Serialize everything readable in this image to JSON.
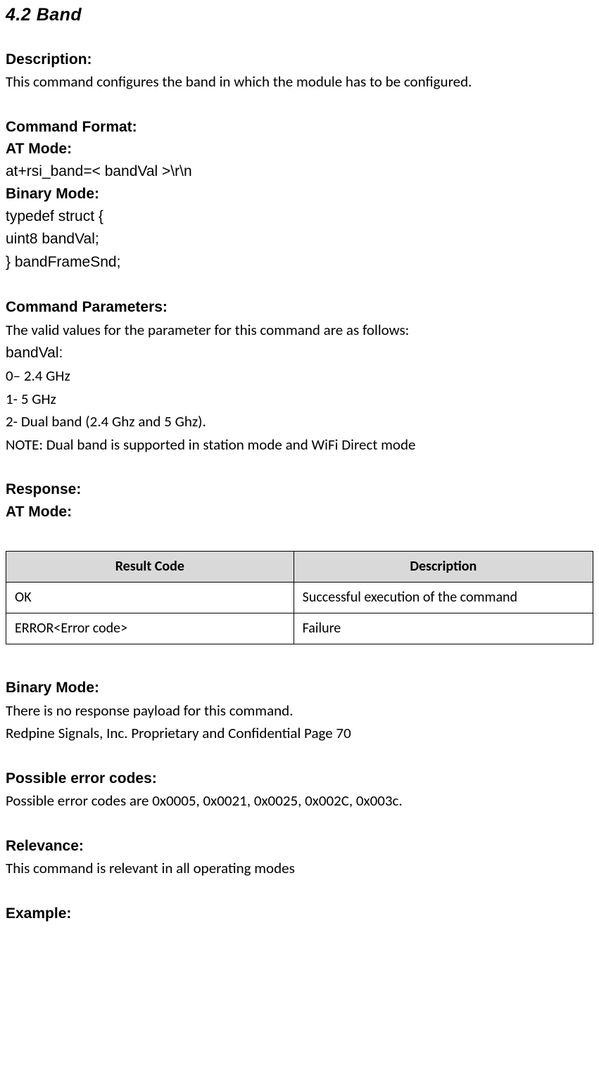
{
  "title": "4.2 Band",
  "description": {
    "heading": "Description:",
    "text": "This command configures the band in which the module has to be configured."
  },
  "command_format": {
    "heading": "Command Format:",
    "at_mode_label": "AT Mode:",
    "at_mode_cmd": "at+rsi_band=< bandVal >\\r\\n",
    "binary_mode_label": "Binary Mode:",
    "binary_lines": [
      "typedef struct {",
      "uint8 bandVal;",
      "} bandFrameSnd;"
    ]
  },
  "command_parameters": {
    "heading": "Command Parameters:",
    "intro": "The valid values for the parameter for this command are as follows:",
    "param_name": "bandVal:",
    "values": [
      "0– 2.4 GHz",
      "1- 5 GHz",
      "2- Dual band (2.4 Ghz and 5 Ghz)."
    ],
    "note": "NOTE: Dual band is supported in station mode and WiFi Direct mode"
  },
  "response": {
    "heading": "Response:",
    "at_mode_label": "AT Mode:",
    "table": {
      "headers": [
        "Result Code",
        "Description"
      ],
      "rows": [
        [
          "OK",
          "Successful execution of the command"
        ],
        [
          "ERROR<Error code>",
          "Failure"
        ]
      ]
    },
    "binary_mode_label": "Binary Mode:",
    "binary_text": "There is no response payload for this command.",
    "footer": "Redpine Signals, Inc. Proprietary and Confidential Page 70"
  },
  "error_codes": {
    "heading": "Possible error codes:",
    "text": "Possible error codes are 0x0005, 0x0021, 0x0025, 0x002C, 0x003c."
  },
  "relevance": {
    "heading": "Relevance:",
    "text": "This command is relevant in all operating modes"
  },
  "example": {
    "heading": "Example:"
  }
}
